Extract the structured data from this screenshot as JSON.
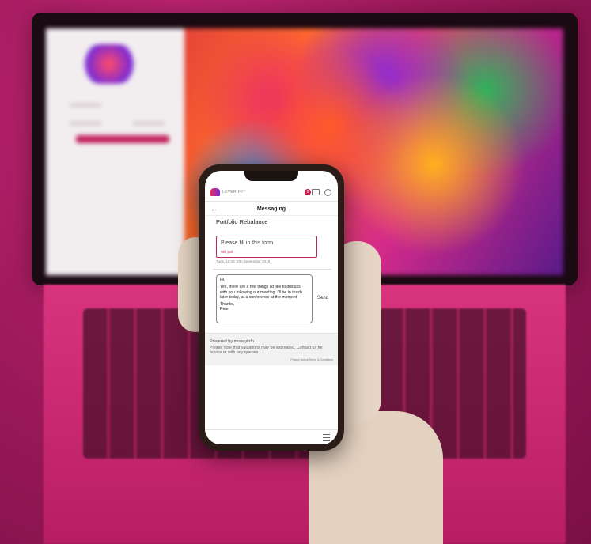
{
  "scene": {
    "description_colors": {
      "background": "#a01a5c",
      "accent": "#c0245e"
    }
  },
  "phone": {
    "header": {
      "brand_text": "LEVERIFFT",
      "notification_count": "0"
    },
    "title": "Messaging",
    "subject": "Portfolio Rebalance",
    "form_card": {
      "message": "Please fill in this form",
      "status": "Will poll"
    },
    "timestamp": "Tues, 10:49 10th September 2019",
    "compose": {
      "greeting": "Hi,",
      "body": "Yes, there are a few things I'd like to discuss with you following our meeting. I'll be in touch later today, at a conference at the moment.",
      "signoff": "Thanks,",
      "name": "Pete"
    },
    "send_label": "Send",
    "footer": {
      "powered_by": "Powered by moneyinfo",
      "note": "Please note that valuations may be estimated. Contact us for advice or with any queries.",
      "links": "Privacy Notice    Terms & Conditions"
    }
  }
}
